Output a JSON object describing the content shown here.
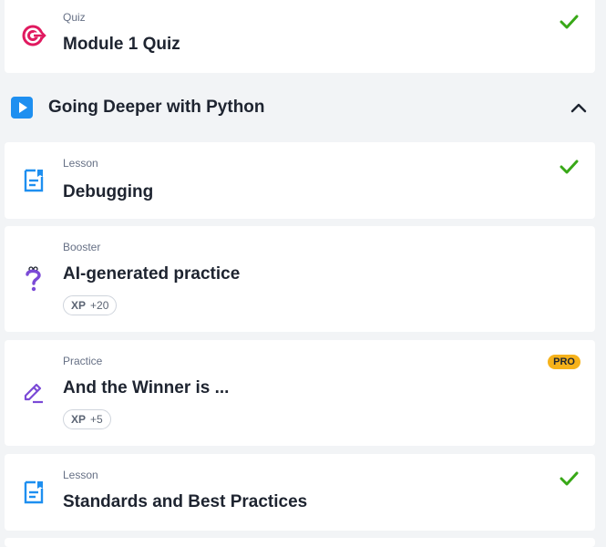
{
  "items_top": {
    "quiz": {
      "type": "Quiz",
      "title": "Module 1 Quiz",
      "icon": "target-icon",
      "completed": true
    }
  },
  "section": {
    "title": "Going Deeper with Python",
    "icon": "play-icon",
    "expanded": true
  },
  "items": [
    {
      "type": "Lesson",
      "title": "Debugging",
      "icon": "document-icon",
      "completed": true
    },
    {
      "type": "Booster",
      "title": "AI-generated practice",
      "icon": "question-icon",
      "xp_label": "XP",
      "xp_value": "+20"
    },
    {
      "type": "Practice",
      "title": "And the Winner is ...",
      "icon": "pencil-icon",
      "xp_label": "XP",
      "xp_value": "+5",
      "badge": "PRO"
    },
    {
      "type": "Lesson",
      "title": "Standards and Best Practices",
      "icon": "document-icon",
      "completed": true
    }
  ],
  "colors": {
    "accent_blue": "#1e8ff0",
    "check_green": "#38a817",
    "quiz_pink": "#e0195f",
    "purple": "#7b4ad6",
    "pro_yellow": "#f6b21b"
  }
}
